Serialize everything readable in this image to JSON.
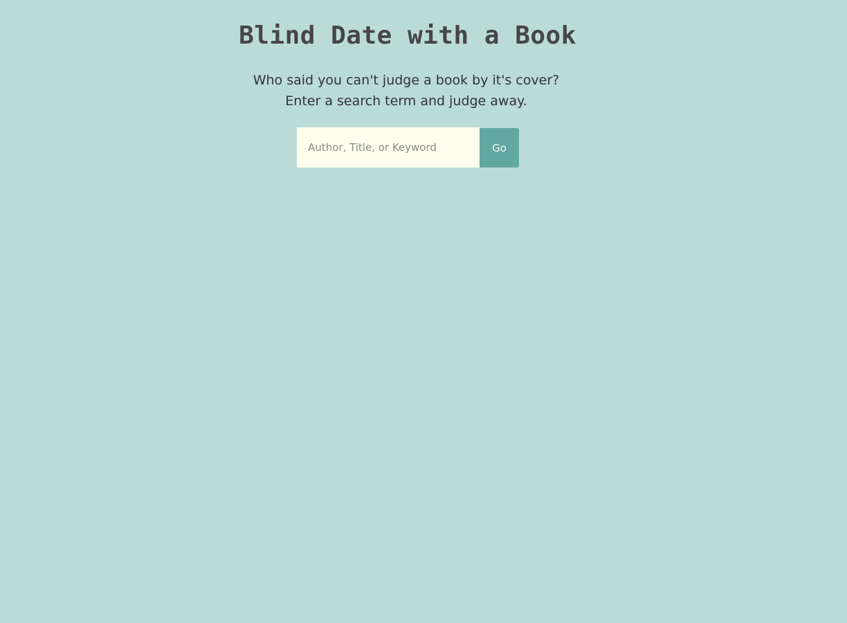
{
  "header": {
    "title": "Blind Date with a Book",
    "tagline_line1": "Who said you can't judge a book by it's cover?",
    "tagline_line2": "Enter a search term and judge away."
  },
  "search": {
    "placeholder": "Author, Title, or Keyword",
    "value": "",
    "button_label": "Go"
  },
  "colors": {
    "background": "#bddcd7",
    "input_background": "#fdfeed",
    "button": "#62a8a0",
    "title_text": "#464646"
  }
}
